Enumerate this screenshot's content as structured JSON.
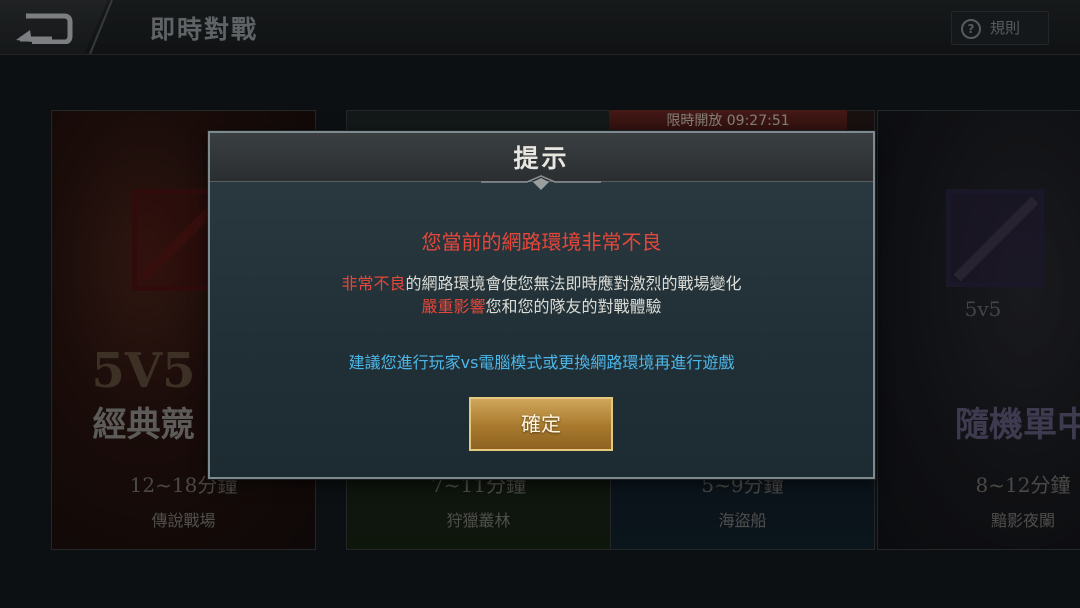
{
  "header": {
    "title": "即時對戰",
    "rules_label": "規則"
  },
  "cards": [
    {
      "emblem_text": "5V5",
      "name": "經典競",
      "time": "12~18分鐘",
      "map": "傳說戰場"
    },
    {
      "time": "7~11分鐘",
      "map": "狩獵叢林"
    },
    {
      "limited_banner": "限時開放 09:27:51",
      "time": "5~9分鐘",
      "map": "海盜船"
    },
    {
      "subtitle": "5v5",
      "name": "隨機單中",
      "time": "8~12分鐘",
      "map": "黯影夜闌"
    }
  ],
  "dialog": {
    "title": "提示",
    "warning": "您當前的網路環境非常不良",
    "line1_red": "非常不良",
    "line1_rest": "的網路環境會使您無法即時應對激烈的戰場變化",
    "line2_red": "嚴重影響",
    "line2_rest": "您和您的隊友的對戰體驗",
    "suggestion": "建議您進行玩家vs電腦模式或更換網路環境再進行遊戲",
    "confirm_label": "確定"
  }
}
